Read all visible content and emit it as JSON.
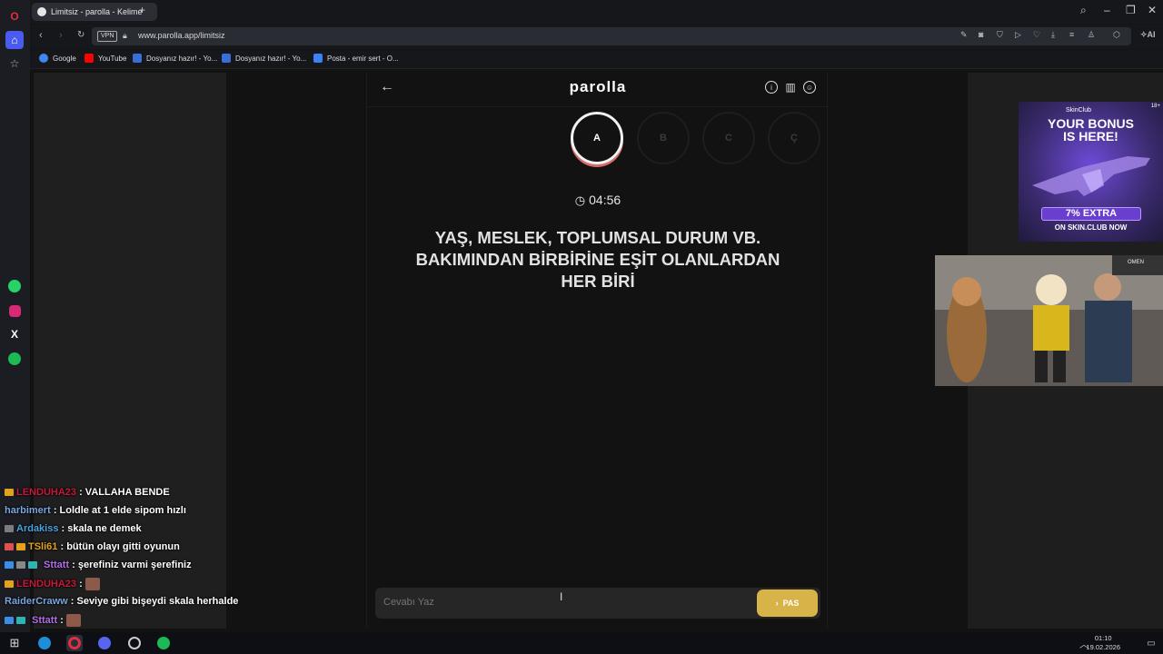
{
  "browser": {
    "tab_title": "Limitsiz - parolla - Kelime",
    "url": "www.parolla.app/limitsiz",
    "vpn_label": "VPN",
    "ai_label": "AI"
  },
  "bookmarks": [
    {
      "label": "Google",
      "color": "#4285f4"
    },
    {
      "label": "YouTube",
      "color": "#ff0000"
    },
    {
      "label": "Dosyanız hazır! - Yo...",
      "color": "#3a6fd8"
    },
    {
      "label": "Dosyanız hazır! - Yo...",
      "color": "#3a6fd8"
    },
    {
      "label": "Posta - emir sert - O...",
      "color": "#3b82f6"
    }
  ],
  "game": {
    "logo": "parolla",
    "letters": [
      "A",
      "B",
      "C",
      "Ç"
    ],
    "active_letter": "A",
    "timer": "04:56",
    "question": "YAŞ, MESLEK, TOPLUMSAL DURUM VB. BAKIMINDAN BİRBİRİNE EŞİT OLANLARDAN HER BİRİ",
    "answer_placeholder": "Cevabı Yaz",
    "pass_label": "PAS"
  },
  "ad": {
    "brand": "SkinClub",
    "age": "18+",
    "headline_1": "YOUR BONUS",
    "headline_2": "IS HERE!",
    "offer": "7% EXTRA",
    "cta": "ON SKIN.CLUB NOW"
  },
  "photo_sign": "OMEN",
  "chat": [
    {
      "user": "LENDUHA23",
      "user_color": "#c8183c",
      "message": ": VALLAHA BENDE",
      "badges": [
        "#e3a21a"
      ]
    },
    {
      "user": "harbimert",
      "user_color": "#7aa6e0",
      "message": ": Loldle at 1 elde sipom hızlı",
      "badges": []
    },
    {
      "user": "Ardakiss",
      "user_color": "#4aa3df",
      "message": ": skala ne demek",
      "badges": [
        "#7c7c7c"
      ]
    },
    {
      "user": "TSli61",
      "user_color": "#e3a21a",
      "message": ": bütün olayı gitti oyunun",
      "badges": [
        "#e05050",
        "#e3a21a"
      ]
    },
    {
      "user": "Sttatt",
      "user_color": "#b06ee8",
      "message": ": şerefiniz varmi şerefiniz",
      "badges": [
        "#3a8ee6",
        "#888",
        "#2fb3b3"
      ]
    },
    {
      "user": "LENDUHA23",
      "user_color": "#c8183c",
      "message": ":",
      "badges": [
        "#e3a21a"
      ],
      "emote": true
    },
    {
      "user": "RaiderCraww",
      "user_color": "#7aa6e0",
      "message": ": Seviye gibi bişeydi skala herhalde",
      "badges": []
    },
    {
      "user": "Sttatt",
      "user_color": "#b06ee8",
      "message": ":",
      "badges": [
        "#3a8ee6",
        "#2fb3b3"
      ],
      "emote": true
    }
  ],
  "taskbar": {
    "time": "01:10",
    "date": "19.02.2026"
  }
}
